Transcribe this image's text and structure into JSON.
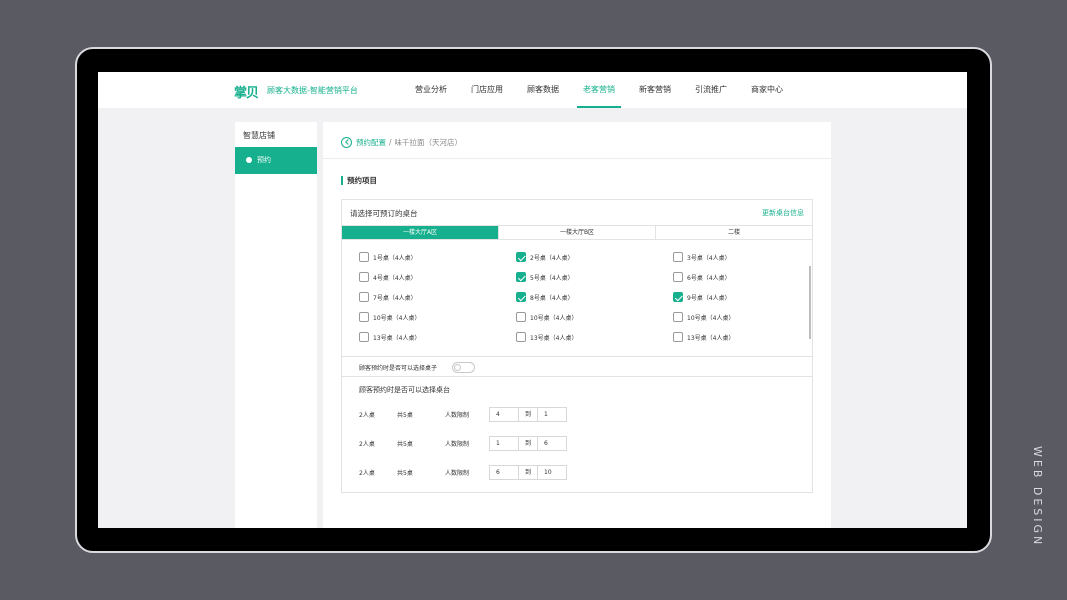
{
  "brand": {
    "logo": "掌贝",
    "subtitle": "顾客大数据-智能营销平台",
    "accent": "#17b08e"
  },
  "nav": [
    {
      "label": "营业分析",
      "active": false
    },
    {
      "label": "门店应用",
      "active": false
    },
    {
      "label": "顾客数据",
      "active": false
    },
    {
      "label": "老客营销",
      "active": true
    },
    {
      "label": "新客营销",
      "active": false
    },
    {
      "label": "引流推广",
      "active": false
    },
    {
      "label": "商家中心",
      "active": false
    }
  ],
  "sidebar": {
    "title": "智慧店铺",
    "items": [
      {
        "label": "预约",
        "active": true
      }
    ]
  },
  "breadcrumb": {
    "link": "预约配置",
    "sep": "/",
    "current": "味千拉面（天河店）"
  },
  "section_title": "预约项目",
  "panel": {
    "heading": "请选择可预订的桌台",
    "update_link": "更新桌台信息",
    "tabs": [
      {
        "label": "一楼大厅A区",
        "active": true
      },
      {
        "label": "一楼大厅B区",
        "active": false
      },
      {
        "label": "二楼",
        "active": false
      }
    ],
    "tables": [
      {
        "label": "1号桌（4人桌）",
        "checked": false
      },
      {
        "label": "2号桌（4人桌）",
        "checked": true
      },
      {
        "label": "3号桌（4人桌）",
        "checked": false
      },
      {
        "label": "4号桌（4人桌）",
        "checked": false
      },
      {
        "label": "5号桌（4人桌）",
        "checked": true
      },
      {
        "label": "6号桌（4人桌）",
        "checked": false
      },
      {
        "label": "7号桌（4人桌）",
        "checked": false
      },
      {
        "label": "8号桌（4人桌）",
        "checked": true
      },
      {
        "label": "9号桌（4人桌）",
        "checked": true
      },
      {
        "label": "10号桌（4人桌）",
        "checked": false
      },
      {
        "label": "10号桌（4人桌）",
        "checked": false
      },
      {
        "label": "10号桌（4人桌）",
        "checked": false
      },
      {
        "label": "13号桌（4人桌）",
        "checked": false
      },
      {
        "label": "13号桌（4人桌）",
        "checked": false
      },
      {
        "label": "13号桌（4人桌）",
        "checked": false
      }
    ],
    "toggle": {
      "label": "顾客预约时是否可以选择桌子",
      "on": false
    },
    "limits_title": "顾客预约时是否可以选择桌台",
    "limits": [
      {
        "type": "2人桌",
        "count": "共5桌",
        "label": "人数限制",
        "from": "4",
        "to_label": "到",
        "to": "1"
      },
      {
        "type": "2人桌",
        "count": "共5桌",
        "label": "人数限制",
        "from": "1",
        "to_label": "到",
        "to": "6"
      },
      {
        "type": "2人桌",
        "count": "共5桌",
        "label": "人数限制",
        "from": "6",
        "to_label": "到",
        "to": "10"
      }
    ]
  },
  "side_caption": "WEB DESIGN"
}
